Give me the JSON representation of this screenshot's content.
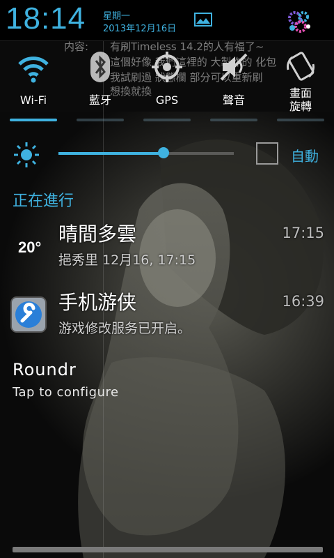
{
  "status": {
    "time": "18:14",
    "weekday": "星期一",
    "date": "2013年12月16日",
    "settings_icon": "settings-shortcut-icon",
    "screenshot_icon": "image-icon"
  },
  "background_text": {
    "line1_label": "内容:",
    "line1": "有刷Timeless 14.2的人有福了~",
    "line2": "這個好像 我們這裡的 大製作的 化包",
    "line3": "我試刷過 狀態欄 部分可以重新刷",
    "line4": "想換就換"
  },
  "toggles": [
    {
      "label": "Wi-Fi",
      "icon": "wifi-icon"
    },
    {
      "label": "藍牙",
      "icon": "bluetooth-icon"
    },
    {
      "label": "GPS",
      "icon": "gps-icon"
    },
    {
      "label": "聲音",
      "icon": "sound-muted-icon"
    },
    {
      "label_line1": "畫面",
      "label_line2": "旋轉",
      "icon": "rotate-icon"
    }
  ],
  "brightness": {
    "level": 0.6,
    "auto_label": "自動",
    "auto_checked": false
  },
  "section_title": "正在進行",
  "notifications": [
    {
      "title": "晴間多雲",
      "text": "挹秀里 12月16, 17:15",
      "time": "17:15",
      "icon_text": "20°"
    },
    {
      "title": "手机游侠",
      "text": "游戏修改服务已开启。",
      "time": "16:39"
    },
    {
      "title": "Roundr",
      "text": "Tap to configure"
    }
  ],
  "colors": {
    "accent": "#3fb2e0",
    "background": "#0b0b0b"
  }
}
